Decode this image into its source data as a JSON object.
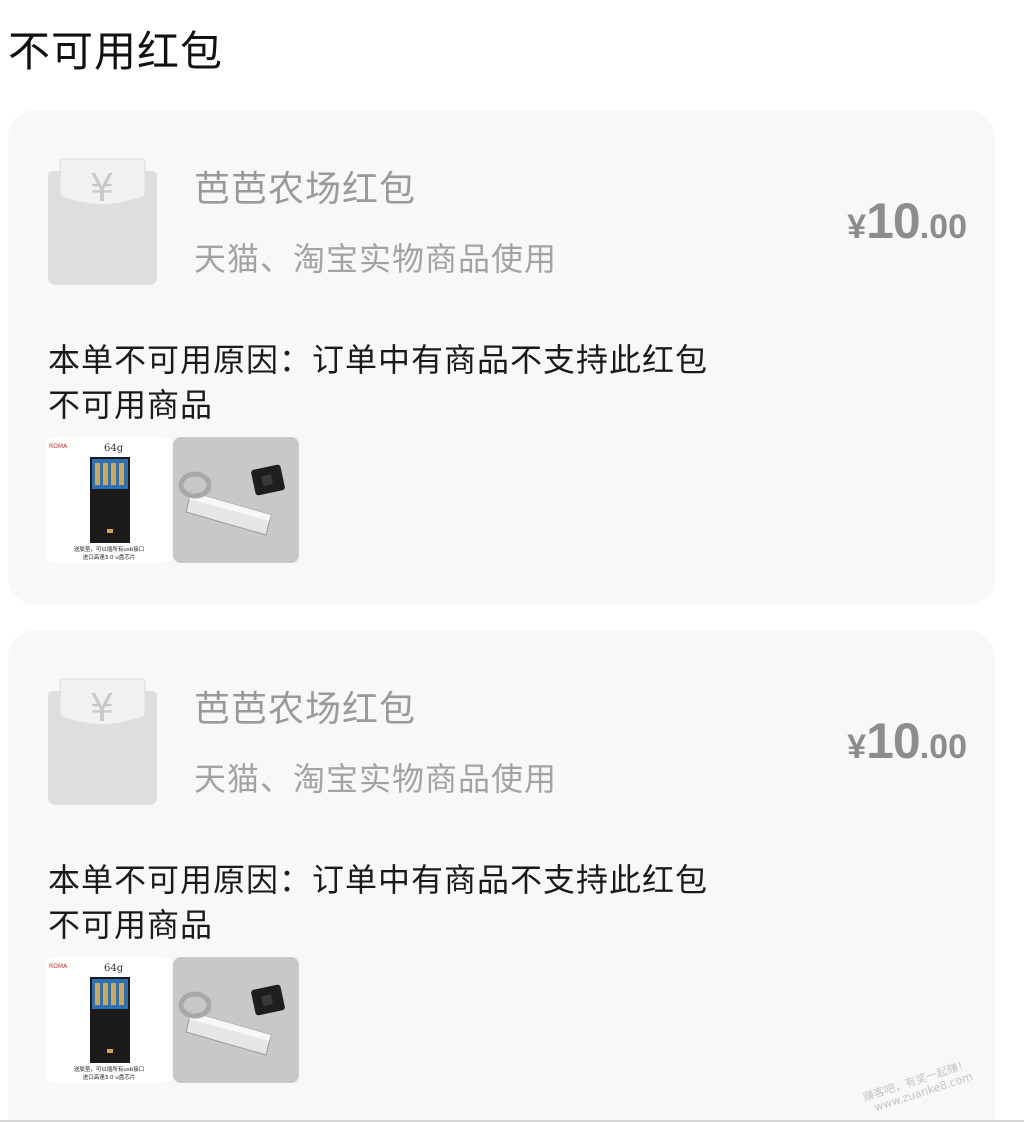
{
  "page": {
    "title": "不可用红包"
  },
  "cards": [
    {
      "name": "芭芭农场红包",
      "scope": "天猫、淘宝实物商品使用",
      "amount": {
        "currency": "¥",
        "integer": "10",
        "decimal": ".00"
      },
      "reason": "本单不可用原因：订单中有商品不支持此红包",
      "goods_label": "不可用商品",
      "goods": [
        {
          "brand": "ROMA",
          "capacity": "64g",
          "caption_line1": "送胶垫，可以插所有usb接口",
          "caption_line2": "进口高速3.0 u盘芯片"
        },
        {
          "type": "metal-usb-drive-photo"
        }
      ]
    },
    {
      "name": "芭芭农场红包",
      "scope": "天猫、淘宝实物商品使用",
      "amount": {
        "currency": "¥",
        "integer": "10",
        "decimal": ".00"
      },
      "reason": "本单不可用原因：订单中有商品不支持此红包",
      "goods_label": "不可用商品",
      "goods": [
        {
          "brand": "ROMA",
          "capacity": "64g",
          "caption_line1": "送胶垫，可以插所有usb接口",
          "caption_line2": "进口高速3.0 u盘芯片"
        },
        {
          "type": "metal-usb-drive-photo"
        }
      ]
    }
  ],
  "watermark": {
    "line1": "赚客吧，有奖一起赚！",
    "line2": "www.zuanke8.com"
  }
}
